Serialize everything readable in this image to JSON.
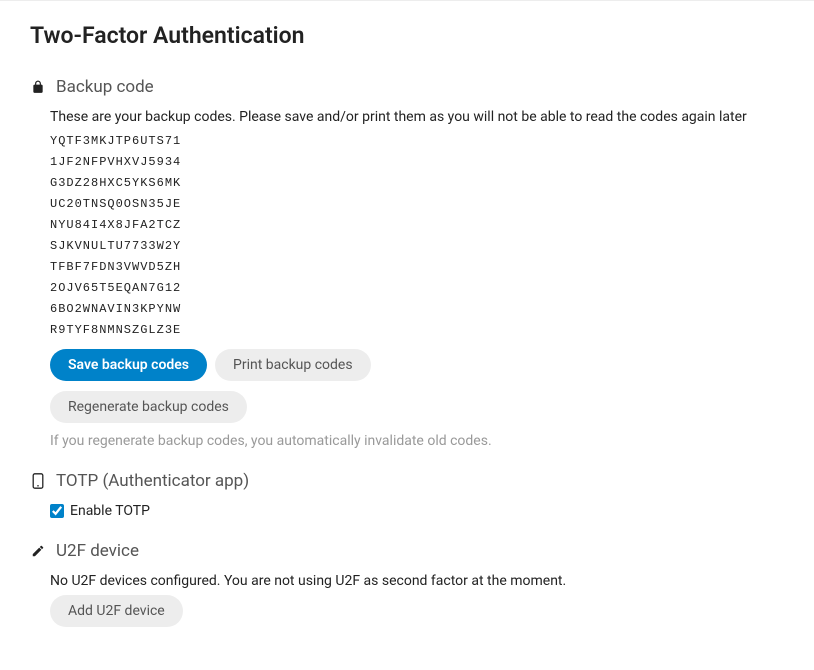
{
  "page": {
    "title": "Two-Factor Authentication"
  },
  "backup": {
    "title": "Backup code",
    "description": "These are your backup codes. Please save and/or print them as you will not be able to read the codes again later",
    "codes": [
      "YQTF3MKJTP6UTS71",
      "1JF2NFPVHXVJ5934",
      "G3DZ28HXC5YKS6MK",
      "UC20TNSQ0OSN35JE",
      "NYU84I4X8JFA2TCZ",
      "SJKVNULTU7733W2Y",
      "TFBF7FDN3VWVD5ZH",
      "2OJV65T5EQAN7G12",
      "6BO2WNAVIN3KPYNW",
      "R9TYF8NMNSZGLZ3E"
    ],
    "save_label": "Save backup codes",
    "print_label": "Print backup codes",
    "regenerate_label": "Regenerate backup codes",
    "hint": "If you regenerate backup codes, you automatically invalidate old codes."
  },
  "totp": {
    "title": "TOTP (Authenticator app)",
    "enable_label": "Enable TOTP",
    "enabled": true
  },
  "u2f": {
    "title": "U2F device",
    "description": "No U2F devices configured. You are not using U2F as second factor at the moment.",
    "add_label": "Add U2F device"
  }
}
